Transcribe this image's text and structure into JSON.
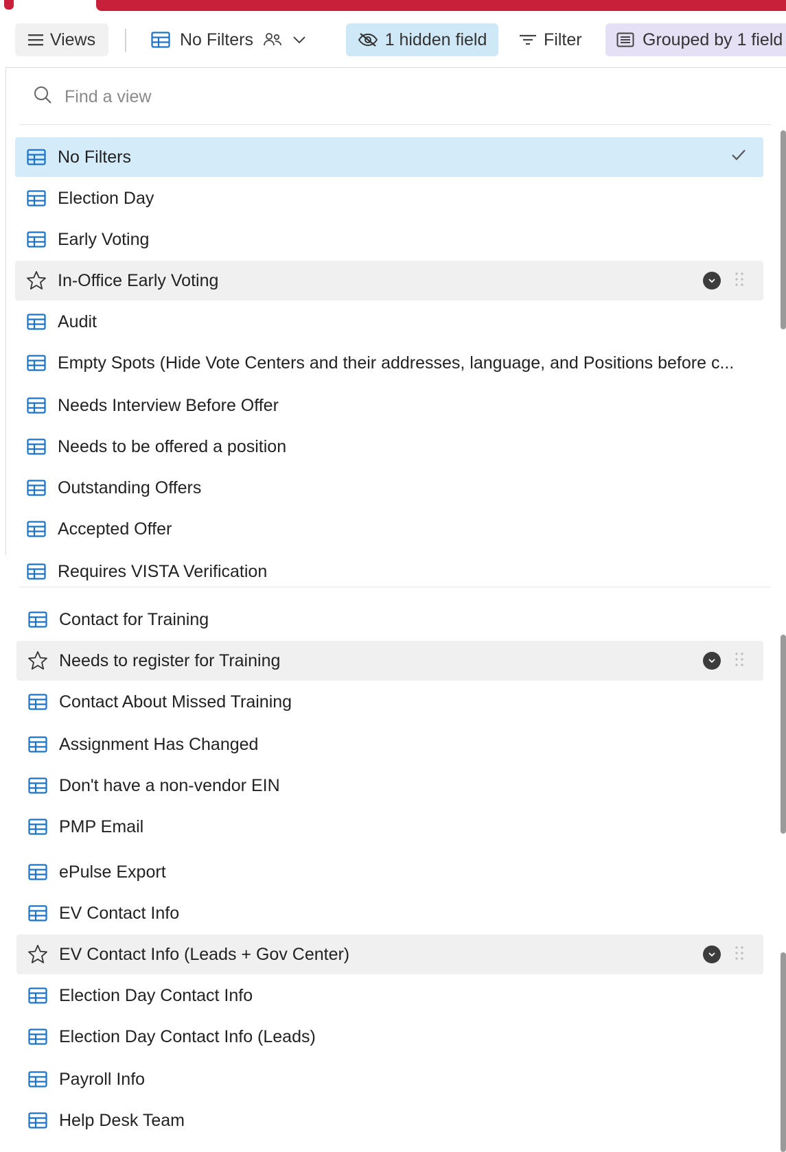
{
  "toolbar": {
    "views_label": "Views",
    "current_view": "No Filters",
    "hidden_fields": "1 hidden field",
    "filter_label": "Filter",
    "grouped_label": "Grouped by 1 field"
  },
  "search": {
    "placeholder": "Find a view"
  },
  "views": [
    {
      "label": "No Filters",
      "icon": "grid-icon",
      "state": "selected"
    },
    {
      "label": "Election Day",
      "icon": "grid-icon"
    },
    {
      "label": "Early Voting",
      "icon": "grid-icon"
    },
    {
      "label": "In-Office Early Voting",
      "icon": "star-icon",
      "state": "hover"
    },
    {
      "label": "Audit",
      "icon": "grid-icon"
    },
    {
      "label": "Empty Spots (Hide Vote Centers and their addresses, language, and Positions before c...",
      "icon": "grid-icon"
    },
    {
      "label": "Needs Interview Before Offer",
      "icon": "grid-icon"
    },
    {
      "label": "Needs to be offered a position",
      "icon": "grid-icon"
    },
    {
      "label": "Outstanding Offers",
      "icon": "grid-icon"
    },
    {
      "label": "Accepted Offer",
      "icon": "grid-icon"
    },
    {
      "label": "Requires VISTA Verification",
      "icon": "grid-icon"
    },
    {
      "label": "Contact for Training",
      "icon": "grid-icon"
    },
    {
      "label": "Needs to register for Training",
      "icon": "star-icon",
      "state": "hover"
    },
    {
      "label": "Contact About Missed Training",
      "icon": "grid-icon"
    },
    {
      "label": "Assignment Has Changed",
      "icon": "grid-icon"
    },
    {
      "label": "Don't have a non-vendor EIN",
      "icon": "grid-icon"
    },
    {
      "label": "PMP Email",
      "icon": "grid-icon"
    },
    {
      "label": "ePulse Export",
      "icon": "grid-icon"
    },
    {
      "label": "EV Contact Info",
      "icon": "grid-icon"
    },
    {
      "label": "EV Contact Info (Leads + Gov Center)",
      "icon": "star-icon",
      "state": "hover"
    },
    {
      "label": "Election Day Contact Info",
      "icon": "grid-icon"
    },
    {
      "label": "Election Day Contact Info (Leads)",
      "icon": "grid-icon"
    },
    {
      "label": "Payroll Info",
      "icon": "grid-icon"
    },
    {
      "label": "Help Desk Team",
      "icon": "grid-icon"
    }
  ],
  "colors": {
    "accent_red": "#c8203a",
    "selected_bg": "#d4ecfa",
    "hidden_field_bg": "#cfe8f7",
    "grouped_bg": "#e6e0f5",
    "icon_blue": "#1a73c8"
  }
}
